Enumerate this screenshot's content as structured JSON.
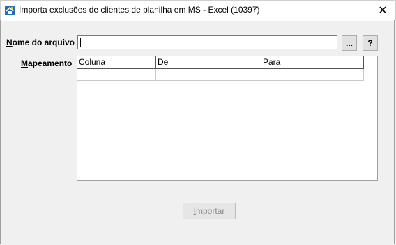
{
  "window": {
    "title": "Importa exclusões de clientes de planilha em MS - Excel (10397)",
    "close_glyph": "✕",
    "icon": "app-icon"
  },
  "form": {
    "file_label_mnemonic": "N",
    "file_label_rest": "ome do arquivo",
    "file_value": "",
    "browse_label": "...",
    "help_label": "?",
    "mapping_label_mnemonic": "M",
    "mapping_label_rest": "apeamento"
  },
  "grid": {
    "columns": [
      "Coluna",
      "De",
      "Para"
    ],
    "rows": [
      [
        "",
        "",
        ""
      ]
    ]
  },
  "actions": {
    "import_mnemonic": "I",
    "import_rest": "mportar",
    "import_enabled": false
  }
}
